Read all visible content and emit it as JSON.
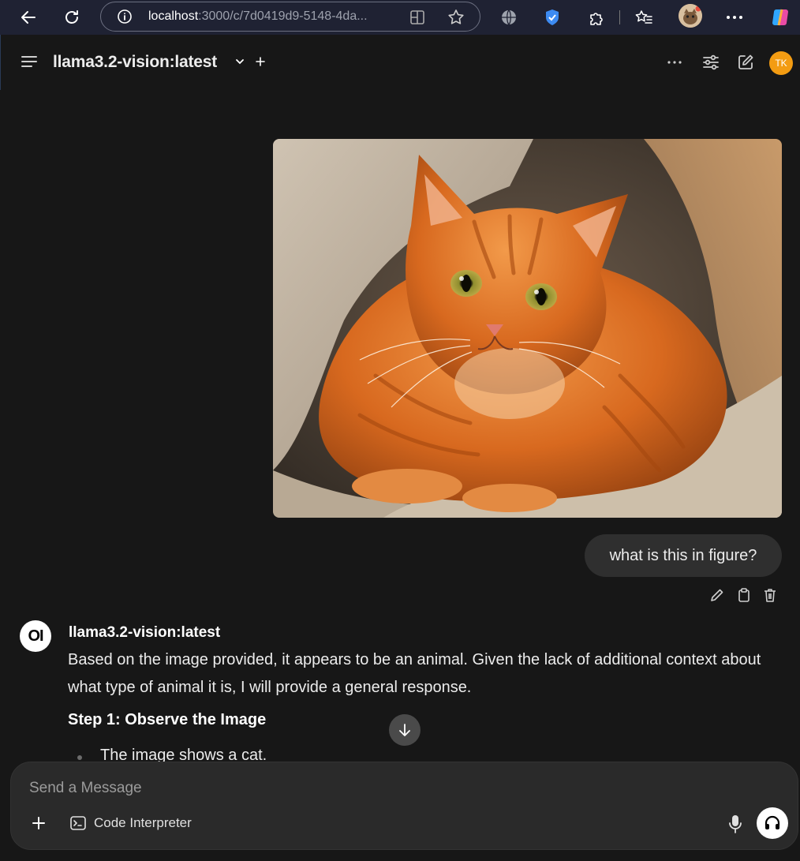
{
  "browser": {
    "url_host": "localhost",
    "url_path": ":3000/c/7d0419d9-5148-4da..."
  },
  "header": {
    "model_name": "llama3.2-vision:latest",
    "user_initials": "TK"
  },
  "chat": {
    "user_message": "what is this in figure?",
    "assistant_name": "llama3.2-vision:latest",
    "assistant_paragraph": "Based on the image provided, it appears to be an animal. Given the lack of additional context about what type of animal it is, I will provide a general response.",
    "step_heading": "Step 1: Observe the Image",
    "bullet_1": "The image shows a cat."
  },
  "composer": {
    "placeholder": "Send a Message",
    "code_interpreter_label": "Code Interpreter"
  },
  "colors": {
    "accent_avatar": "#f39c12",
    "background": "#171717",
    "bubble": "#2f2f2f"
  }
}
